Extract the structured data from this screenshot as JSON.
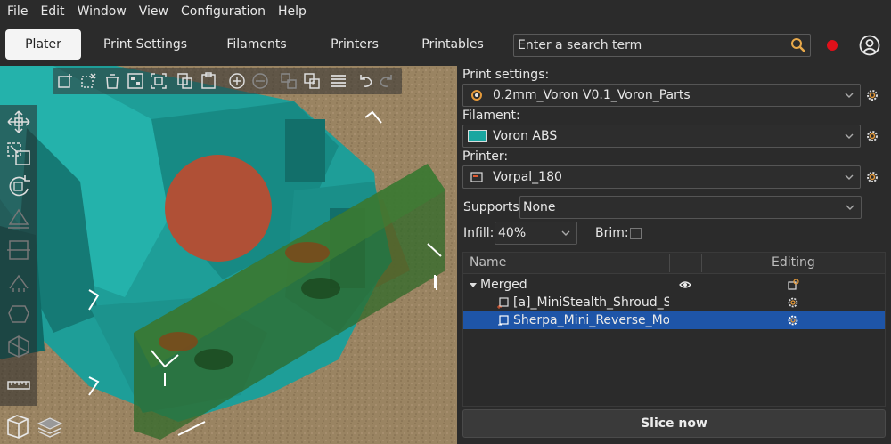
{
  "menu": [
    "File",
    "Edit",
    "Window",
    "View",
    "Configuration",
    "Help"
  ],
  "tabs": {
    "plater": "Plater",
    "print_settings": "Print Settings",
    "filaments": "Filaments",
    "printers": "Printers",
    "printables": "Printables"
  },
  "search": {
    "placeholder": "Enter a search term"
  },
  "colors": {
    "accent_record": "#e0101a",
    "selection": "#1e55a8",
    "filament": "#1aa6a0"
  },
  "right_panel": {
    "print_settings_label": "Print settings:",
    "print_profile": "0.2mm_Voron V0.1_Voron_Parts",
    "filament_label": "Filament:",
    "filament_profile": "Voron ABS",
    "printer_label": "Printer:",
    "printer_profile": "Vorpal_180",
    "supports_label": "Supports:",
    "supports_value": "None",
    "infill_label": "Infill:",
    "infill_value": "40%",
    "brim_label": "Brim:",
    "brim_checked": false
  },
  "object_list": {
    "col_name": "Name",
    "col_editing": "Editing",
    "rows": [
      {
        "name": "Merged",
        "expanded": true
      },
      {
        "name": "[a]_MiniStealth_Shroud_She"
      },
      {
        "name": "Sherpa_Mini_Reverse_Mour",
        "selected": true
      }
    ]
  },
  "slice_button": "Slice now"
}
